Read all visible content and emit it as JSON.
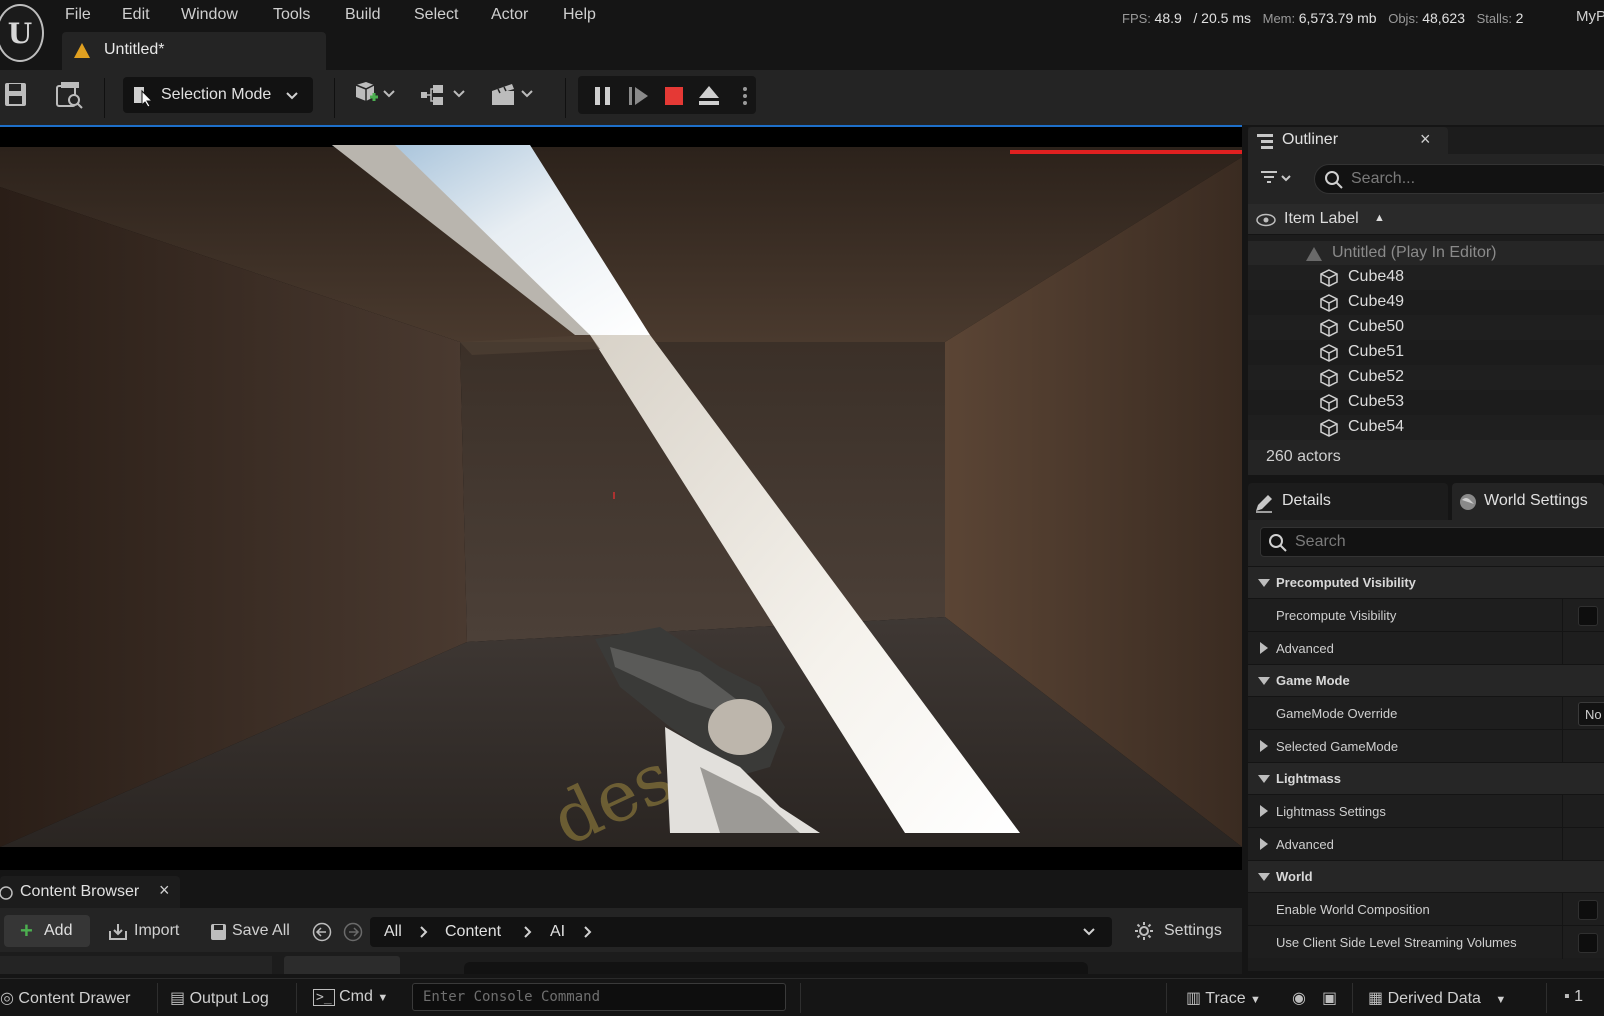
{
  "menu": {
    "items": [
      "File",
      "Edit",
      "Window",
      "Tools",
      "Build",
      "Select",
      "Actor",
      "Help"
    ],
    "logo": "U"
  },
  "stats": {
    "fps_label": "FPS:",
    "fps": "48.9",
    "ms": "/ 20.5 ms",
    "mem_label": "Mem:",
    "mem": "6,573.79 mb",
    "objs_label": "Objs:",
    "objs": "48,623",
    "stalls_label": "Stalls:",
    "stalls": "2",
    "user": "MyP"
  },
  "doc_tab": {
    "title": "Untitled*"
  },
  "toolbar": {
    "selection_mode": "Selection Mode"
  },
  "outliner": {
    "title": "Outliner",
    "close": "×",
    "search_placeholder": "Search...",
    "column_label": "Item Label",
    "sort_arrow": "▲",
    "root": "Untitled (Play In Editor)",
    "items": [
      "Cube48",
      "Cube49",
      "Cube50",
      "Cube51",
      "Cube52",
      "Cube53",
      "Cube54"
    ],
    "actor_count": "260 actors"
  },
  "details": {
    "tab_details": "Details",
    "tab_world_settings": "World Settings",
    "search_placeholder": "Search",
    "rows": [
      {
        "type": "cat",
        "label": "Precomputed Visibility"
      },
      {
        "type": "prop",
        "label": "Precompute Visibility",
        "control": "checkbox"
      },
      {
        "type": "sub",
        "label": "Advanced"
      },
      {
        "type": "cat",
        "label": "Game Mode"
      },
      {
        "type": "prop",
        "label": "GameMode Override",
        "control": "dropdown",
        "value": "No"
      },
      {
        "type": "sub",
        "label": "Selected GameMode"
      },
      {
        "type": "cat",
        "label": "Lightmass"
      },
      {
        "type": "sub",
        "label": "Lightmass Settings"
      },
      {
        "type": "sub",
        "label": "Advanced"
      },
      {
        "type": "cat",
        "label": "World"
      },
      {
        "type": "prop",
        "label": "Enable World Composition",
        "control": "checkbox"
      },
      {
        "type": "prop",
        "label": "Use Client Side Level Streaming Volumes",
        "control": "checkbox"
      }
    ]
  },
  "content_browser": {
    "tab_title": "Content Browser",
    "close": "×",
    "add": "Add",
    "import": "Import",
    "save_all": "Save All",
    "path": [
      "All",
      "Content",
      "AI"
    ],
    "settings": "Settings"
  },
  "statusbar": {
    "content_drawer": "Content Drawer",
    "output_log": "Output Log",
    "cmd": "Cmd",
    "console_placeholder": "Enter Console Command",
    "trace": "Trace",
    "derived_data": "Derived Data",
    "source_control_count": "1"
  },
  "colors": {
    "accent_blue": "#1e6fc9",
    "stop_red": "#e53935",
    "warning": "#e0a020",
    "add_green": "#4caf50"
  }
}
